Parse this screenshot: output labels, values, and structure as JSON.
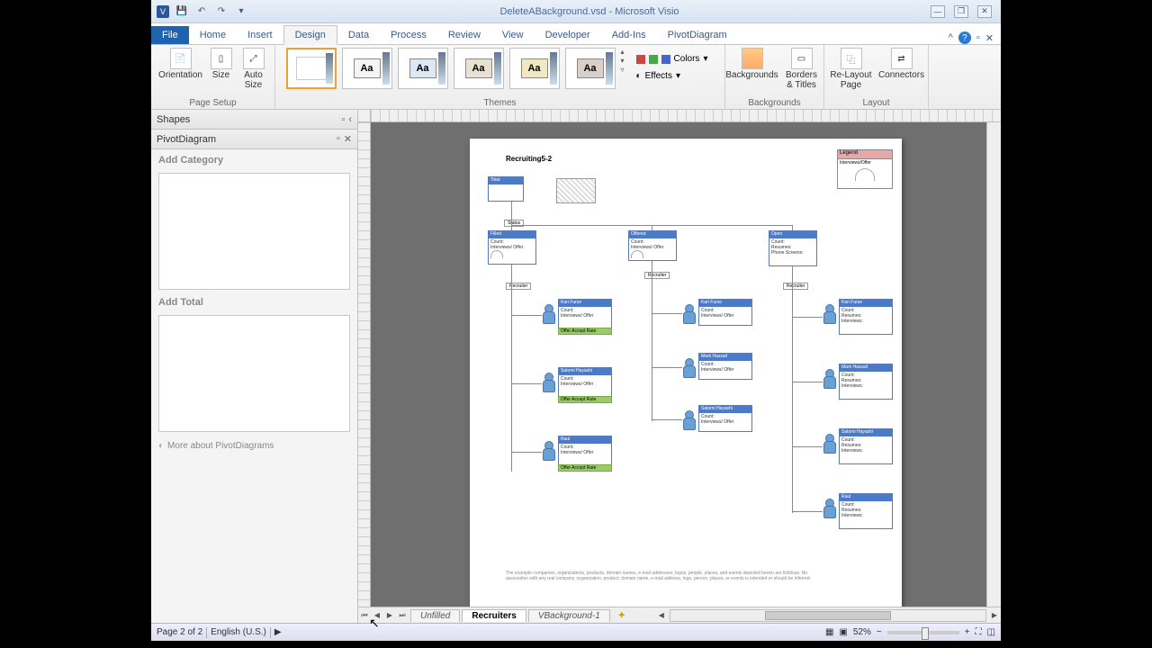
{
  "title": "DeleteABackground.vsd - Microsoft Visio",
  "tabs": {
    "file": "File",
    "home": "Home",
    "insert": "Insert",
    "design": "Design",
    "data": "Data",
    "process": "Process",
    "review": "Review",
    "view": "View",
    "developer": "Developer",
    "addins": "Add-Ins",
    "pivot": "PivotDiagram"
  },
  "ribbon": {
    "pagesetup": {
      "label": "Page Setup",
      "orientation": "Orientation",
      "size": "Size",
      "autosize": "Auto Size"
    },
    "themes": {
      "label": "Themes",
      "aa": "Aa",
      "colors": "Colors",
      "effects": "Effects"
    },
    "backgrounds": {
      "label": "Backgrounds",
      "backgrounds": "Backgrounds",
      "borders": "Borders & Titles"
    },
    "layout": {
      "label": "Layout",
      "relayout": "Re-Layout Page",
      "connectors": "Connectors"
    }
  },
  "shapes": {
    "header": "Shapes",
    "pivot": "PivotDiagram",
    "addcat": "Add Category",
    "addtotal": "Add Total",
    "more": "More about PivotDiagrams"
  },
  "canvas": {
    "pagetitle": "Recruiting5-2",
    "legend": "Legend",
    "legendrow": "Interviews/Offer",
    "statuslbl": "Status",
    "recruiterlbl": "Recruiter",
    "count": "Count:",
    "intoff": "Interviews/ Offer",
    "resumes": "Resumes:",
    "phone": "Phone Screens:",
    "interviews": "Interviews:",
    "acceptrate": "Offer Accept Rate",
    "footer1": "The example companies, organizations, products, domain names, e-mail addresses, logos, people, places, and events depicted herein are fictitious. No",
    "footer2": "association with any real company, organization, product, domain name, e-mail address, logo, person, places, or events is intended or should be inferred."
  },
  "pagetabs": {
    "unfilled": "Unfilled",
    "recruiters": "Recruiters",
    "vback": "VBackground-1"
  },
  "status": {
    "page": "Page 2 of 2",
    "lang": "English (U.S.)",
    "zoom": "52%"
  }
}
